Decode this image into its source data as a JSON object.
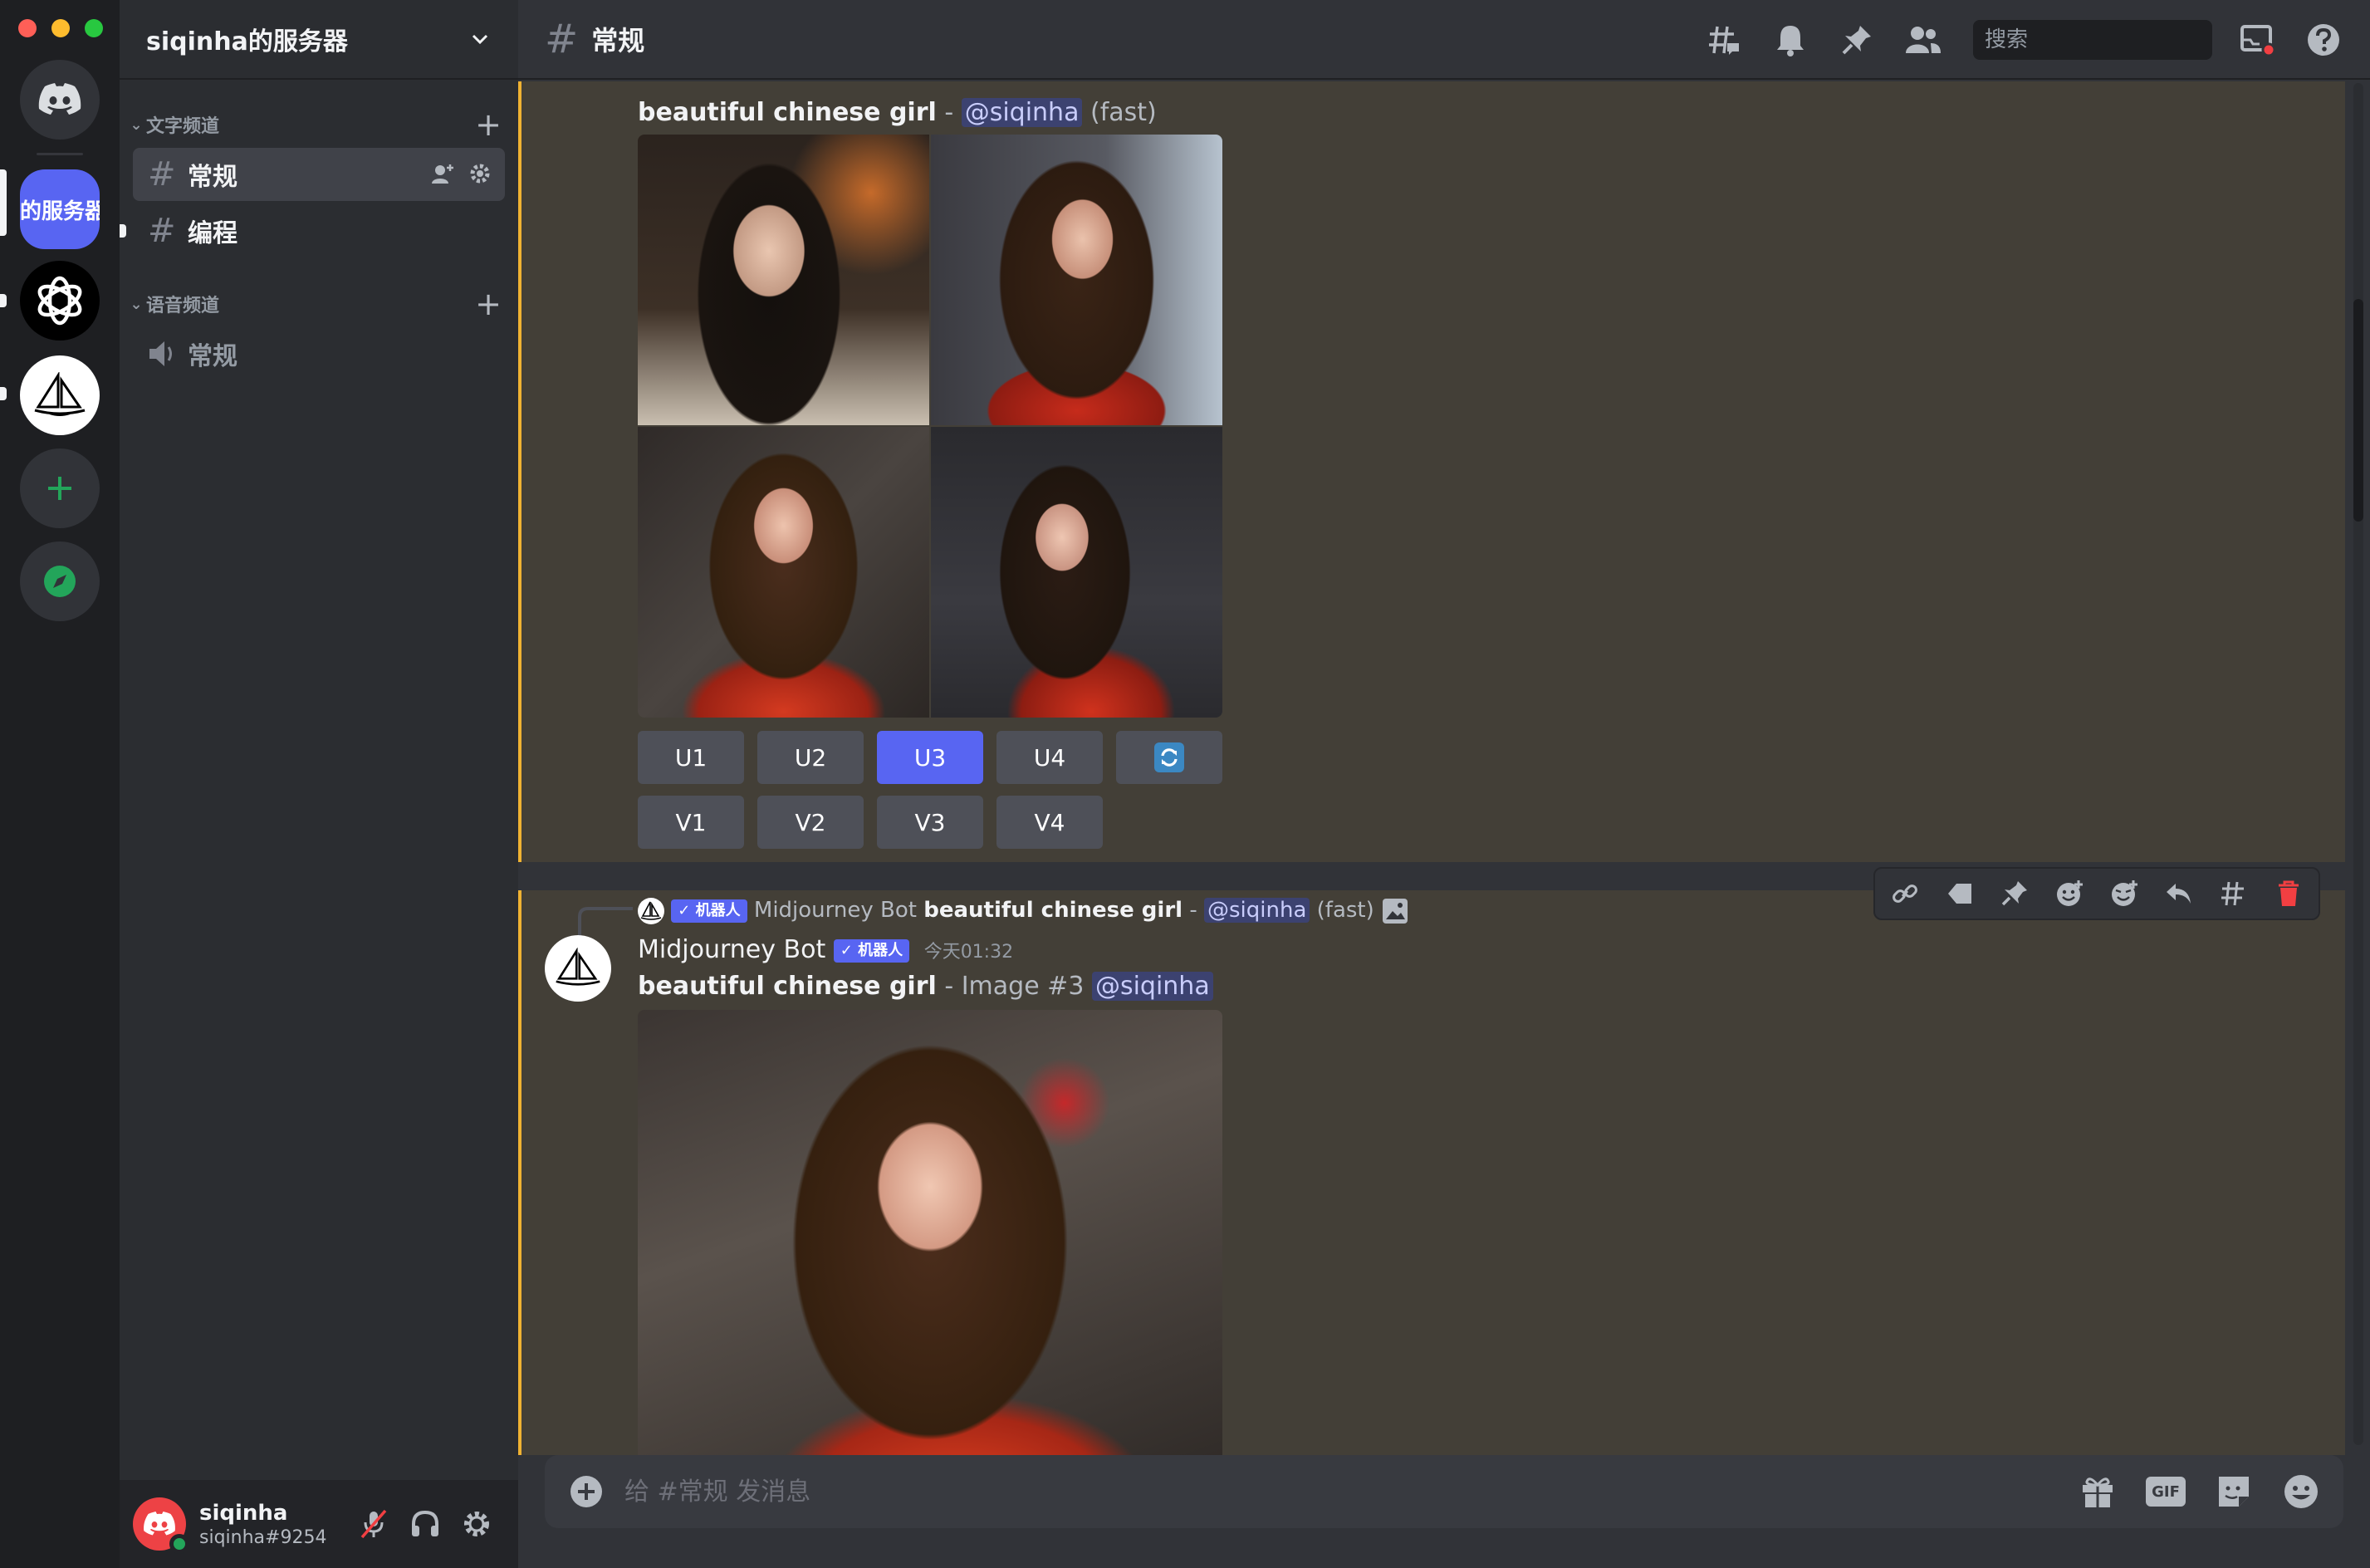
{
  "window": {
    "controls": [
      {
        "name": "close",
        "color": "#ff5f57"
      },
      {
        "name": "minimize",
        "color": "#febc2e"
      },
      {
        "name": "zoom",
        "color": "#28c840"
      }
    ]
  },
  "rail": {
    "home_icon": "discord-logo-icon",
    "active_server_label": "的服务器",
    "servers": [
      "openai-server",
      "midjourney-server"
    ],
    "add_icon": "plus-icon",
    "explore_icon": "compass-icon"
  },
  "sidebar": {
    "server_name": "siqinha的服务器",
    "text_category": "文字频道",
    "text_channels": [
      "常规",
      "编程"
    ],
    "voice_category": "语音频道",
    "voice_channels": [
      "常规"
    ]
  },
  "user": {
    "name": "siqinha",
    "tag": "siqinha#9254",
    "status_color": "#23a55a"
  },
  "header": {
    "channel": "常规",
    "search_placeholder": "搜索"
  },
  "message1": {
    "prompt": "beautiful chinese girl",
    "separator": " - ",
    "mention": "@siqinha",
    "mode": "(fast)",
    "upscale_buttons": [
      "U1",
      "U2",
      "U3",
      "U4"
    ],
    "variation_buttons": [
      "V1",
      "V2",
      "V3",
      "V4"
    ],
    "active_button": "U3",
    "reroll_icon": "refresh-icon"
  },
  "message2": {
    "reply_bot_badge": "✓ 机器人",
    "reply_author": "Midjourney Bot",
    "reply_prompt": "beautiful chinese girl",
    "reply_separator": " - ",
    "reply_mention": "@siqinha",
    "reply_mode": "(fast)",
    "author": "Midjourney Bot",
    "bot_badge": "✓ 机器人",
    "timestamp": "今天01:32",
    "prompt": "beautiful chinese girl",
    "suffix": " - Image #3 ",
    "mention": "@siqinha"
  },
  "composer": {
    "placeholder": "给 #常规 发消息",
    "gif_label": "GIF"
  }
}
